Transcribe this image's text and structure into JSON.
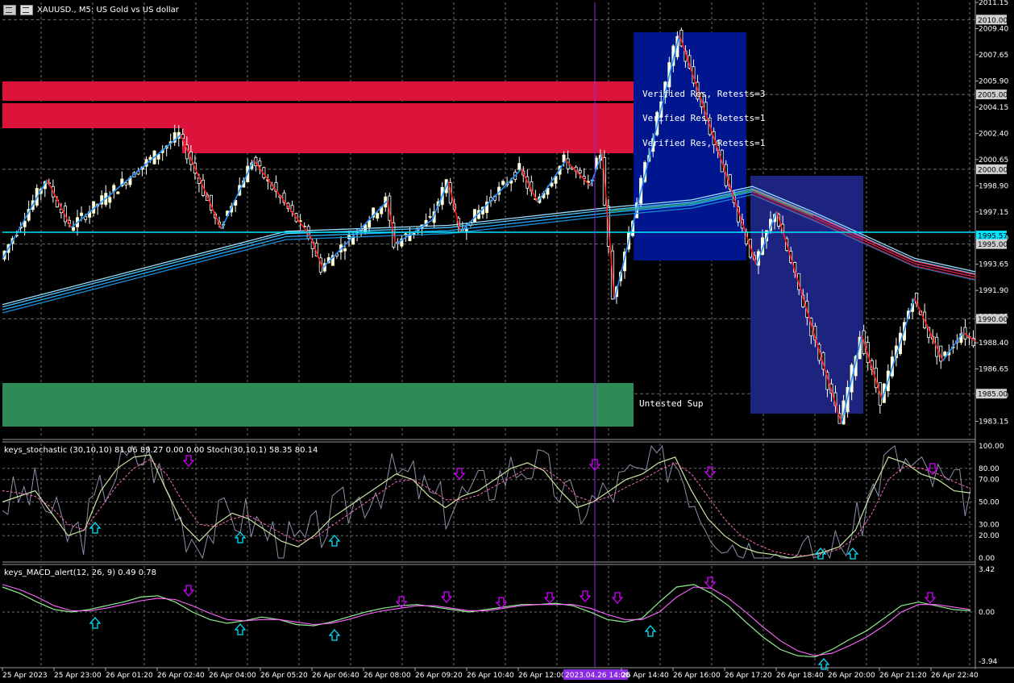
{
  "header": {
    "title": "XAUUSD., M5:  US Gold vs US dollar",
    "chart_icon": "chart-grid-icon",
    "chart_type_icon": "bar-chart-icon"
  },
  "colors": {
    "background": "#000000",
    "grid": "#6b6b6b",
    "bull": "#ffffff",
    "bear": "#ffffff",
    "zone_resistance": "#dc143c",
    "zone_support": "#2e8b57",
    "box_blue": "#00168f",
    "box_blue2": "#1c2480",
    "zigzag_up": "#1e90ff",
    "zigzag_down": "#ff1a1a",
    "ma_blue": "#1fb0ff",
    "ma_green": "#3cb371",
    "ma_red": "#dc143c",
    "stoch_main": "#b0c4de",
    "stoch_signal": "#ff69b4",
    "macd_main": "#90ee90",
    "macd_signal": "#ff66ff",
    "arrow_up": "#00e5ff",
    "arrow_down": "#d400ff",
    "hline": "#00e5ff",
    "cursor": "#8a2be2"
  },
  "price_axis": {
    "ticks": [
      "2011.15",
      "2009.40",
      "2007.65",
      "2005.90",
      "2004.15",
      "2002.40",
      "2000.65",
      "1998.90",
      "1997.15",
      "1995.40",
      "1993.65",
      "1991.90",
      "1990.15",
      "1988.40",
      "1986.65",
      "1984.90",
      "1983.15"
    ],
    "boxed_levels": [
      "2010.00",
      "2005.00",
      "2000.00",
      "1995.57",
      "1995.00",
      "1990.00",
      "1985.00"
    ],
    "current_price": "1995.57"
  },
  "zones": {
    "verified_res_1": "Verified Res, Retests=3",
    "verified_res_2": "Verified Res, Retests=1",
    "verified_res_3": "Verified Res, Retests=1",
    "untested_sup": "Untested Sup"
  },
  "stochastic": {
    "label": "keys_stochastic (30,10,10) 81.06 89.27 0.00 0.00  Stoch(30,10,1) 58.35 80.14",
    "ticks": [
      "100.00",
      "80.00",
      "70.00",
      "50.00",
      "30.00",
      "20.00",
      "0.00"
    ]
  },
  "macd": {
    "label": "keys_MACD_alert(12, 26, 9) 0.49 0.78",
    "ticks": [
      "3.42",
      "0.00",
      "-3.94"
    ]
  },
  "time_axis": {
    "labels": [
      "25 Apr 2023",
      "25 Apr 23:00",
      "26 Apr 01:20",
      "26 Apr 02:40",
      "26 Apr 04:00",
      "26 Apr 05:20",
      "26 Apr 06:40",
      "26 Apr 08:00",
      "26 Apr 09:20",
      "26 Apr 10:40",
      "26 Apr 12:00",
      "2023.04.26 14:00",
      "26 Apr 14:40",
      "26 Apr 16:00",
      "26 Apr 17:20",
      "26 Apr 18:40",
      "26 Apr 20:00",
      "26 Apr 21:20",
      "26 Apr 22:40"
    ],
    "cursor_label": "2023.04.26 14:00"
  },
  "chart_data": [
    {
      "type": "candlestick",
      "title": "XAUUSD., M5:  US Gold vs US dollar",
      "xlabel": "",
      "ylabel": "",
      "ylim": [
        1982.1,
        2011.15
      ],
      "zigzag_points": [
        {
          "t": 0,
          "p": 1994.0
        },
        {
          "t": 11,
          "p": 1999.3
        },
        {
          "t": 17,
          "p": 1996.1
        },
        {
          "t": 44,
          "p": 2002.3
        },
        {
          "t": 54,
          "p": 1996.0
        },
        {
          "t": 62,
          "p": 2000.6
        },
        {
          "t": 76,
          "p": 1995.5
        },
        {
          "t": 79,
          "p": 1993.4
        },
        {
          "t": 95,
          "p": 1997.9
        },
        {
          "t": 97,
          "p": 1995.0
        },
        {
          "t": 106,
          "p": 1996.6
        },
        {
          "t": 110,
          "p": 1999.2
        },
        {
          "t": 113,
          "p": 1995.8
        },
        {
          "t": 128,
          "p": 2000.0
        },
        {
          "t": 132,
          "p": 1997.8
        },
        {
          "t": 139,
          "p": 2000.6
        },
        {
          "t": 145,
          "p": 1998.9
        },
        {
          "t": 148,
          "p": 2001.1
        },
        {
          "t": 151,
          "p": 1991.3
        },
        {
          "t": 167,
          "p": 2009.0
        },
        {
          "t": 186,
          "p": 1993.6
        },
        {
          "t": 191,
          "p": 1997.2
        },
        {
          "t": 207,
          "p": 1983.0
        },
        {
          "t": 212,
          "p": 1988.9
        },
        {
          "t": 217,
          "p": 1984.6
        },
        {
          "t": 225,
          "p": 1991.4
        },
        {
          "t": 232,
          "p": 1987.2
        },
        {
          "t": 237,
          "p": 1989.1
        },
        {
          "t": 240,
          "p": 1988.5
        }
      ],
      "ma_ribbon": [
        {
          "t": 0,
          "p": 1990.6
        },
        {
          "t": 40,
          "p": 1993.4
        },
        {
          "t": 70,
          "p": 1995.5
        },
        {
          "t": 110,
          "p": 1995.9
        },
        {
          "t": 150,
          "p": 1997.1
        },
        {
          "t": 170,
          "p": 1997.6
        },
        {
          "t": 185,
          "p": 1998.5
        },
        {
          "t": 200,
          "p": 1996.8
        },
        {
          "t": 225,
          "p": 1993.7
        },
        {
          "t": 240,
          "p": 1992.8
        }
      ],
      "levels": [
        2010.0,
        2005.0,
        2000.0,
        1995.57,
        1995.0,
        1990.0,
        1985.0
      ]
    },
    {
      "type": "line",
      "title": "keys_stochastic (30,10,10) 81.06 89.27 0.00 0.00  Stoch(30,10,1) 58.35 80.14",
      "ylim": [
        0,
        100
      ],
      "main": [
        50,
        55,
        60,
        40,
        20,
        25,
        60,
        80,
        90,
        92,
        60,
        30,
        15,
        30,
        40,
        35,
        25,
        15,
        10,
        20,
        35,
        45,
        55,
        65,
        75,
        70,
        55,
        45,
        55,
        60,
        70,
        80,
        85,
        78,
        60,
        45,
        50,
        60,
        70,
        75,
        85,
        90,
        60,
        35,
        20,
        10,
        5,
        3,
        0,
        2,
        5,
        10,
        25,
        60,
        90,
        85,
        75,
        70,
        60,
        58
      ],
      "signal": [
        60,
        58,
        55,
        45,
        30,
        25,
        45,
        65,
        80,
        88,
        75,
        50,
        30,
        28,
        35,
        38,
        30,
        22,
        15,
        18,
        28,
        38,
        48,
        58,
        68,
        70,
        62,
        52,
        52,
        56,
        64,
        72,
        80,
        80,
        70,
        55,
        50,
        55,
        63,
        70,
        78,
        85,
        75,
        55,
        35,
        20,
        12,
        6,
        3,
        2,
        4,
        8,
        18,
        40,
        70,
        82,
        80,
        75,
        68,
        62
      ]
    },
    {
      "type": "line",
      "title": "keys_MACD_alert(12, 26, 9) 0.49 0.78",
      "ylim": [
        -3.94,
        3.42
      ],
      "main": [
        2.0,
        1.5,
        0.8,
        0.2,
        0.0,
        0.2,
        0.5,
        0.8,
        1.2,
        1.3,
        0.8,
        0.0,
        -0.6,
        -0.9,
        -0.7,
        -0.4,
        -0.6,
        -1.0,
        -1.1,
        -0.8,
        -0.4,
        0.0,
        0.3,
        0.5,
        0.6,
        0.4,
        0.2,
        0.0,
        0.2,
        0.4,
        0.6,
        0.6,
        0.7,
        0.5,
        0.0,
        -0.6,
        -0.8,
        -0.5,
        0.8,
        2.0,
        2.2,
        1.5,
        0.5,
        -0.8,
        -2.0,
        -3.0,
        -3.5,
        -3.6,
        -3.0,
        -2.2,
        -1.5,
        -0.5,
        0.5,
        0.8,
        0.5,
        0.2,
        0.1
      ],
      "signal": [
        2.2,
        1.8,
        1.2,
        0.5,
        0.1,
        0.1,
        0.3,
        0.6,
        0.9,
        1.1,
        1.0,
        0.5,
        -0.1,
        -0.6,
        -0.7,
        -0.6,
        -0.6,
        -0.8,
        -1.0,
        -0.9,
        -0.6,
        -0.2,
        0.1,
        0.3,
        0.5,
        0.5,
        0.3,
        0.1,
        0.1,
        0.3,
        0.5,
        0.6,
        0.6,
        0.6,
        0.3,
        -0.2,
        -0.6,
        -0.6,
        0.0,
        1.2,
        2.0,
        1.9,
        1.1,
        0.0,
        -1.2,
        -2.3,
        -3.1,
        -3.5,
        -3.3,
        -2.7,
        -2.0,
        -1.1,
        0.0,
        0.6,
        0.6,
        0.4,
        0.2
      ]
    }
  ]
}
